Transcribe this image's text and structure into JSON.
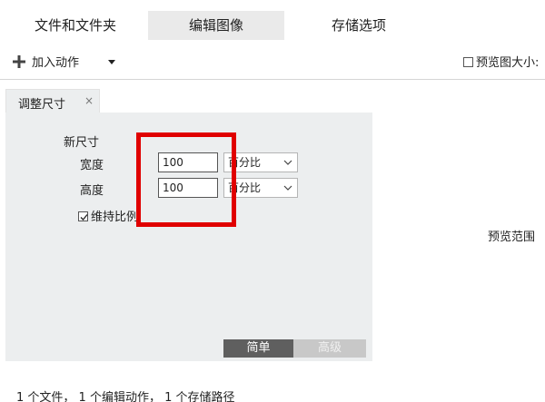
{
  "tabs": [
    {
      "label": "文件和文件夹",
      "active": false
    },
    {
      "label": "编辑图像",
      "active": true
    },
    {
      "label": "存储选项",
      "active": false
    }
  ],
  "toolbar": {
    "add_action_label": "加入动作",
    "preview_size_label": "预览图大小:"
  },
  "action_tab": {
    "label": "调整尺寸",
    "close_glyph": "×"
  },
  "resize": {
    "section_title": "新尺寸",
    "width_label": "宽度",
    "width_value": "100",
    "width_unit": "百分比",
    "height_label": "高度",
    "height_value": "100",
    "height_unit": "百分比",
    "keep_ratio_label": "维持比例",
    "keep_ratio_checked": true
  },
  "modes": {
    "simple": "简单",
    "advanced": "高级",
    "active": "simple"
  },
  "preview": {
    "range_label": "预览范围"
  },
  "status": {
    "text": "1 个文件， 1 个编辑动作， 1 个存储路径"
  },
  "colors": {
    "highlight": "#e00000",
    "panel_bg": "#eceeef",
    "active_tab_bg": "#eaeaea",
    "mode_active_bg": "#5f5f5f",
    "mode_inactive_bg": "#c8c8c8"
  }
}
